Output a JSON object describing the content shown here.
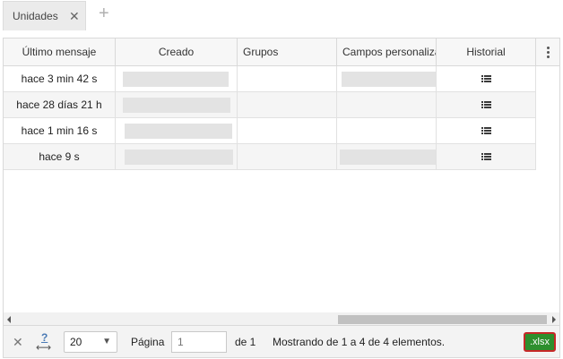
{
  "tab": {
    "label": "Unidades",
    "close": "✕",
    "add": "+"
  },
  "columns": [
    {
      "label": "Último mensaje"
    },
    {
      "label": "Creado"
    },
    {
      "label": "Grupos"
    },
    {
      "label": "Campos personalizados"
    },
    {
      "label": "Historial"
    }
  ],
  "rows": [
    {
      "last_message": "hace 3 min 42 s"
    },
    {
      "last_message": "hace 28 días 21 h"
    },
    {
      "last_message": "hace 1 min 16 s"
    },
    {
      "last_message": "hace 9 s"
    }
  ],
  "footer": {
    "page_size": "20",
    "page_label": "Página",
    "page_value": "1",
    "of_label": "de 1",
    "info": "Mostrando de 1 a 4 de 4 elementos.",
    "export_label": ".xlsx"
  },
  "colors": {
    "export_bg": "#2d8f2d",
    "export_border": "#c62828"
  }
}
